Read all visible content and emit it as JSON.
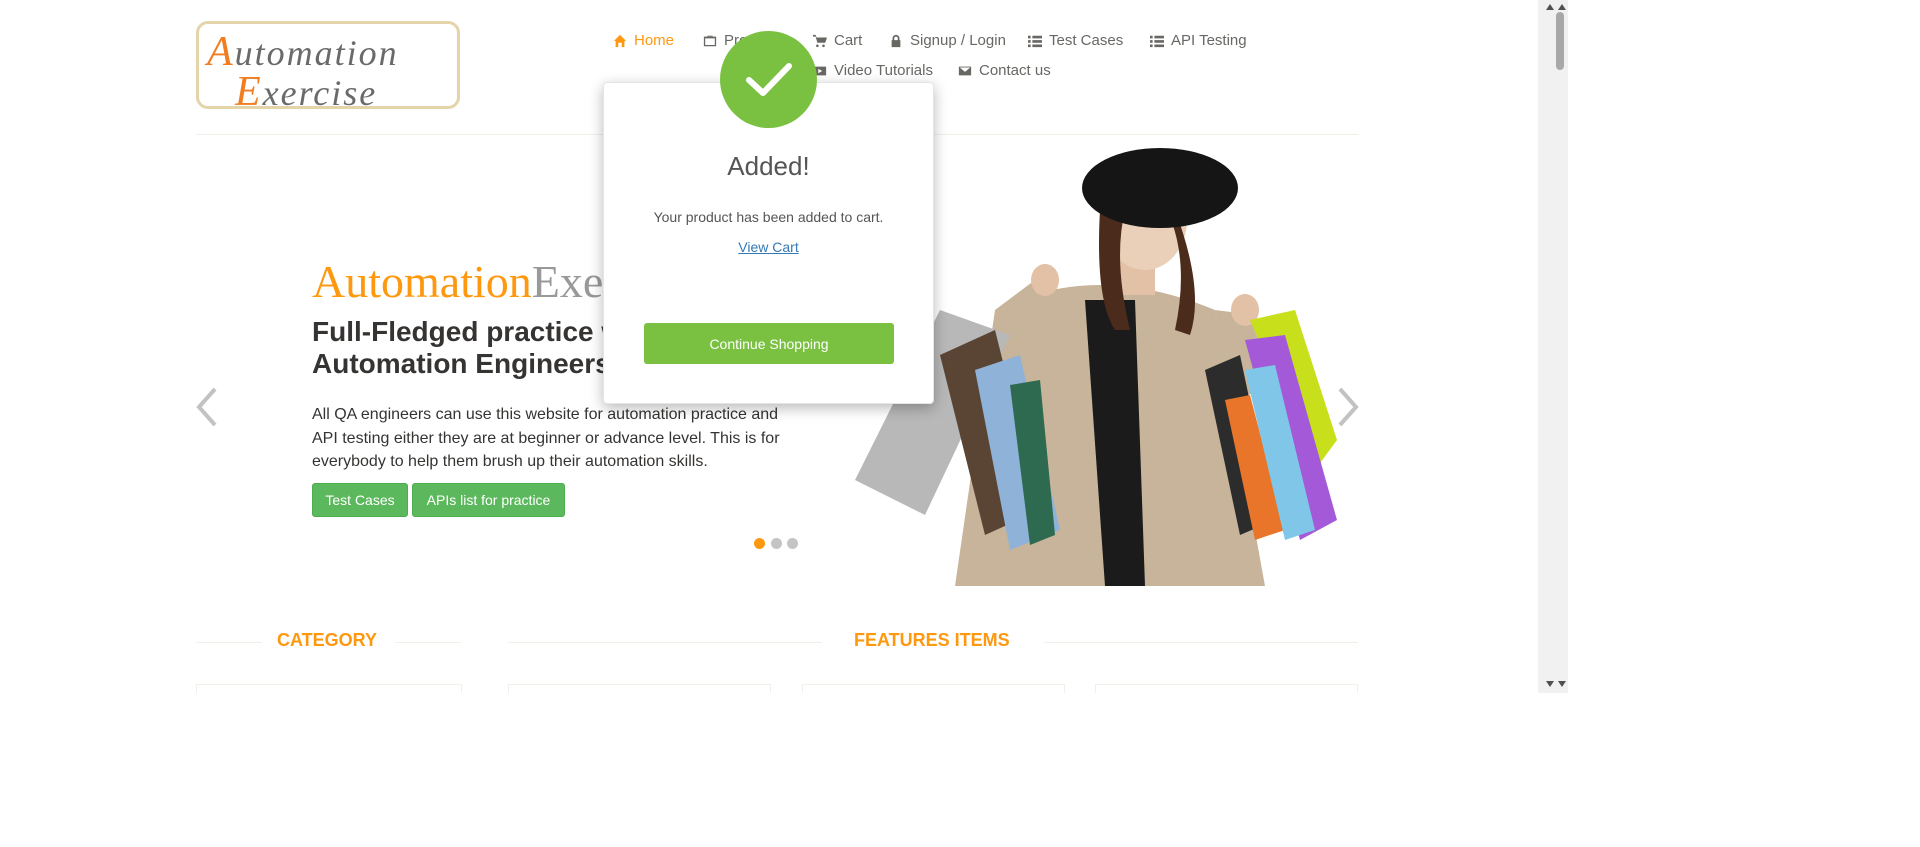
{
  "logo": {
    "line1_first": "A",
    "line1_rest": "utomation",
    "line2_first": "E",
    "line2_rest": "xercise"
  },
  "nav": {
    "home": "Home",
    "products": "Products",
    "cart": "Cart",
    "signup": "Signup / Login",
    "test_cases": "Test Cases",
    "api_testing": "API Testing",
    "video_tutorials": "Video Tutorials",
    "contact": "Contact us"
  },
  "slider": {
    "brand_part1": "Automation",
    "brand_part2": "Exercise",
    "title": "Full-Fledged practice website for Automation Engineers",
    "description": "All QA engineers can use this website for automation practice and API testing either they are at beginner or advance level. This is for everybody to help them brush up their automation skills.",
    "test_cases_button": "Test Cases",
    "apis_button": "APIs list for practice",
    "active_slide": 1,
    "slide_count": 3
  },
  "sections": {
    "category": "CATEGORY",
    "features": "FEATURES ITEMS"
  },
  "modal": {
    "title": "Added!",
    "message": "Your product has been added to cart.",
    "view_cart": "View Cart",
    "continue": "Continue Shopping"
  },
  "colors": {
    "accent": "#fe980f",
    "success": "#7ac142",
    "button_green": "#5cb85c",
    "link": "#337ab7"
  }
}
